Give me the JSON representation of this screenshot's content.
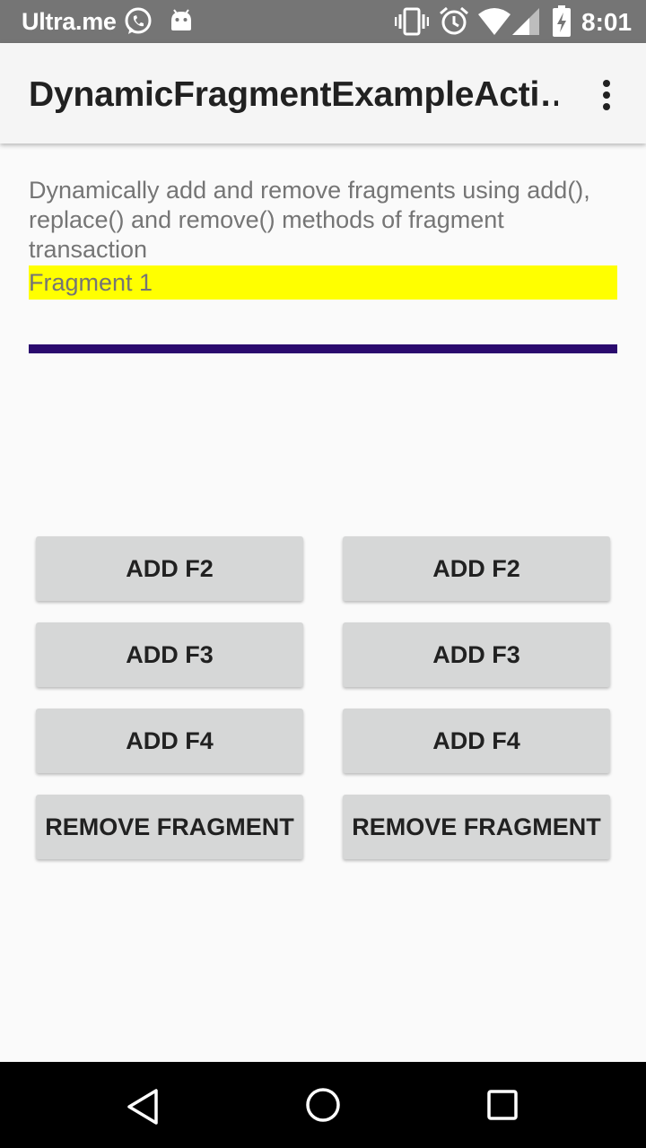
{
  "status_bar": {
    "carrier": "Ultra.me",
    "time": "8:01",
    "icons": [
      "whatsapp-icon",
      "android-icon",
      "vibrate-icon",
      "alarm-icon",
      "wifi-icon",
      "signal-icon",
      "battery-charging-icon"
    ]
  },
  "app_bar": {
    "title": "DynamicFragmentExampleActi…",
    "menu_icon": "overflow-menu-icon"
  },
  "content": {
    "description": "Dynamically add and remove fragments using add(), replace() and remove() methods of fragment transaction",
    "fragment_label": "Fragment 1",
    "fragment_color": "#ffff00",
    "divider_color": "#2a0a6e"
  },
  "buttons": {
    "left": [
      "ADD F2",
      "ADD F3",
      "ADD F4",
      "REMOVE FRAGMENT"
    ],
    "right": [
      "ADD F2",
      "ADD F3",
      "ADD F4",
      "REMOVE FRAGMENT"
    ]
  },
  "nav_bar": {
    "icons": [
      "back-icon",
      "home-icon",
      "recents-icon"
    ]
  }
}
